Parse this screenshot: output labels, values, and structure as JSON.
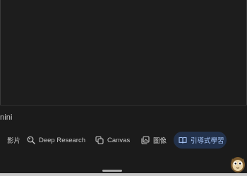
{
  "top_area": {},
  "composer": {
    "prompt_text": "nini"
  },
  "toolbar": {
    "video_label": "影片",
    "deep_research_label": "Deep Research",
    "canvas_label": "Canvas",
    "image_label": "圖像",
    "guided_learning_label": "引導式學習"
  },
  "icons": {
    "deep_research": "deep-research-icon",
    "canvas": "canvas-icon",
    "image": "image-icon",
    "guided_learning": "book-icon"
  },
  "colors": {
    "background": "#1f1f1f",
    "text": "#c9c9c9",
    "active_chip_bg": "#22314b",
    "active_chip_text": "#a8c7fa"
  }
}
